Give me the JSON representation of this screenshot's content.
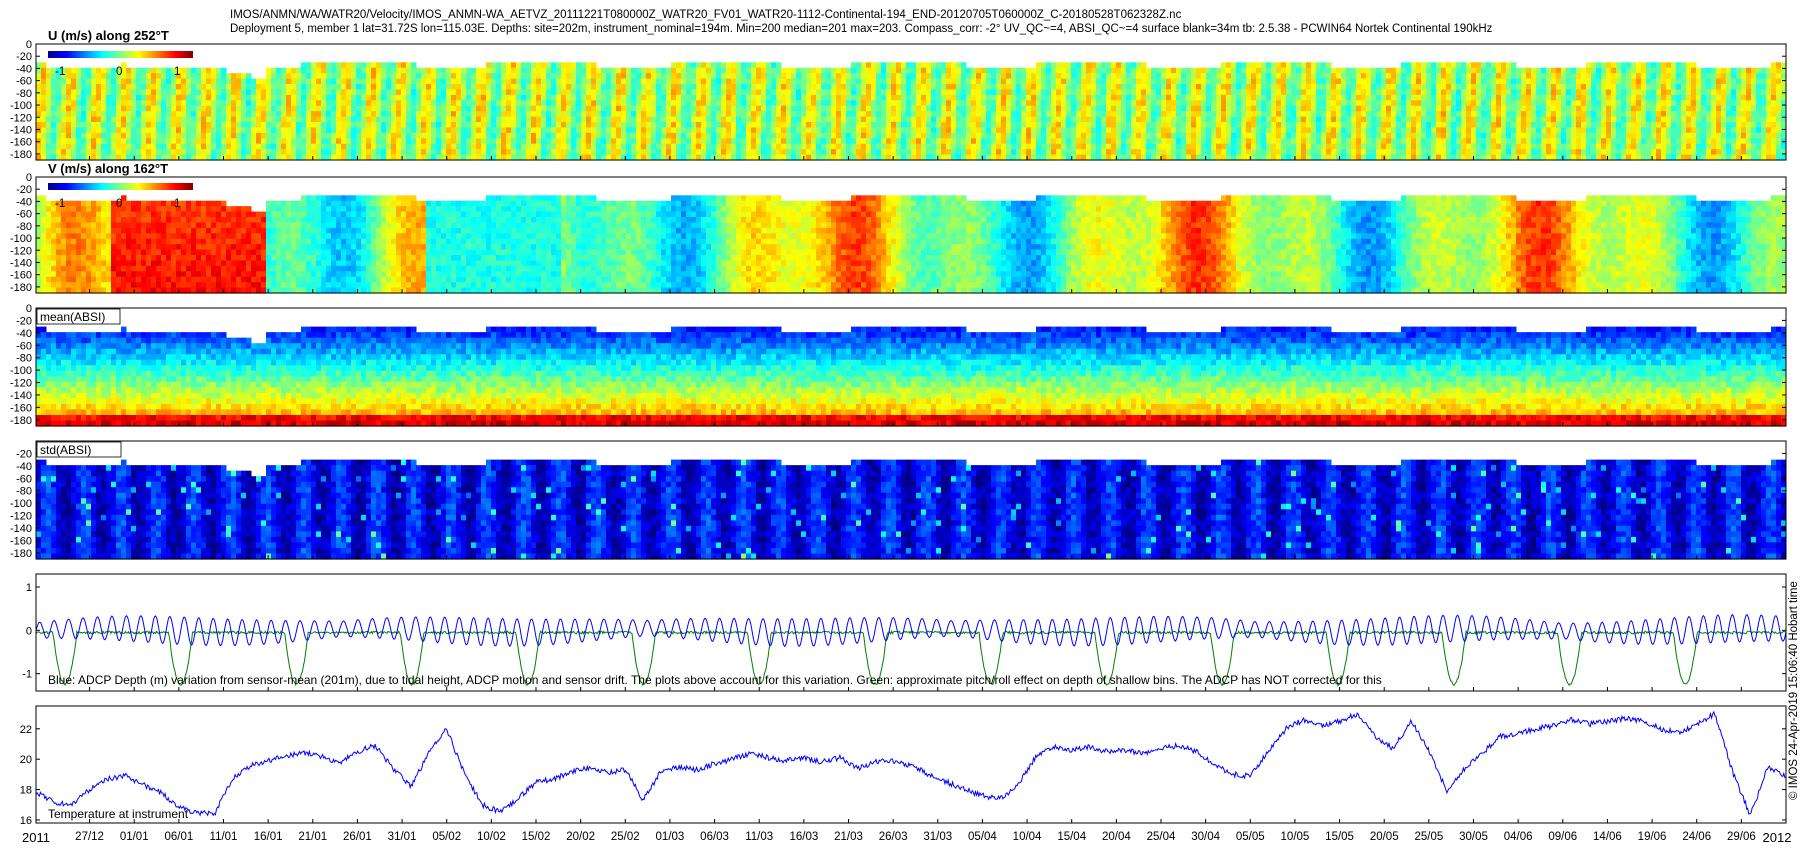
{
  "header": {
    "line1": "IMOS/ANMN/WA/WATR20/Velocity/IMOS_ANMN-WA_AETVZ_20111221T080000Z_WATR20_FV01_WATR20-1112-Continental-194_END-20120705T060000Z_C-20180528T062328Z.nc",
    "line2": "Deployment 5, member 1 lat=31.72S lon=115.03E. Depths: site=202m, instrument_nominal=194m. Min=200 median=201 max=203. Compass_corr: -2° UV_QC~=4, ABSI_QC~=4 surface blank=34m tb: 2.5.38 - PCWIN64 Nortek Continental 190kHz"
  },
  "side_note": "© IMOS 24-Apr-2019 15:06:40 Hobart time",
  "colors": {
    "axis": "#000000",
    "depth_line": "#0000ff",
    "pitch_roll_line": "#007f00",
    "temperature_line": "#0000ff",
    "blank_region": "#ffffff"
  },
  "x_axis": {
    "year_start_label": "2011",
    "year_end_label": "2012",
    "tick_labels": [
      "27/12",
      "01/01",
      "06/01",
      "11/01",
      "16/01",
      "21/01",
      "26/01",
      "31/01",
      "05/02",
      "10/02",
      "15/02",
      "20/02",
      "25/02",
      "01/03",
      "06/03",
      "11/03",
      "16/03",
      "21/03",
      "26/03",
      "31/03",
      "05/04",
      "10/04",
      "15/04",
      "20/04",
      "25/04",
      "30/04",
      "05/05",
      "10/05",
      "15/05",
      "20/05",
      "25/05",
      "30/05",
      "04/06",
      "09/06",
      "14/06",
      "19/06",
      "24/06",
      "29/06"
    ]
  },
  "colorbar": {
    "tick_labels": [
      "-1",
      "0",
      "1"
    ]
  },
  "chart_data": [
    {
      "type": "heatmap",
      "title": "U (m/s) along 252°T",
      "yticks": [
        "0",
        "-20",
        "-40",
        "-60",
        "-80",
        "-100",
        "-120",
        "-140",
        "-160",
        "-180"
      ],
      "clim": [
        -1,
        1
      ],
      "colormap": "jet",
      "has_colorbar": true
    },
    {
      "type": "heatmap",
      "title": "V (m/s) along 162°T",
      "yticks": [
        "0",
        "-20",
        "-40",
        "-60",
        "-80",
        "-100",
        "-120",
        "-140",
        "-160",
        "-180"
      ],
      "clim": [
        -1,
        1
      ],
      "colormap": "jet",
      "has_colorbar": true
    },
    {
      "type": "heatmap",
      "title": "mean(ABSI)",
      "yticks": [
        "0",
        "-20",
        "-40",
        "-60",
        "-80",
        "-100",
        "-120",
        "-140",
        "-160",
        "-180"
      ],
      "colormap": "jet",
      "has_colorbar": false
    },
    {
      "type": "heatmap",
      "title": "std(ABSI)",
      "yticks": [
        "-20",
        "-40",
        "-60",
        "-80",
        "-100",
        "-120",
        "-140",
        "-160",
        "-180"
      ],
      "colormap": "jet",
      "has_colorbar": false
    },
    {
      "type": "line",
      "yticks": [
        "1",
        "0",
        "-1"
      ],
      "ylim": [
        -1.4,
        1.3
      ],
      "caption": "Blue: ADCP Depth (m) variation from sensor-mean (201m), due to tidal height, ADCP motion and sensor drift. The plots above account for this variation. Green: approximate pitch/roll effect on depth of shallow bins. The ADCP has NOT corrected for this",
      "series": [
        {
          "color": "#0000ff",
          "amplitude": 0.3
        },
        {
          "color": "#007f00",
          "amplitude": 1.0
        }
      ]
    },
    {
      "type": "line",
      "yticks": [
        "22",
        "20",
        "18",
        "16"
      ],
      "ylim": [
        15.8,
        23.5
      ],
      "caption": "Temperature at instrument",
      "series": [
        {
          "color": "#0000ff",
          "x_days": [
            0,
            2,
            4,
            6,
            8,
            10,
            12,
            14,
            16,
            18,
            20,
            22,
            24,
            26,
            28,
            30,
            32,
            34,
            36,
            38,
            40,
            42,
            44,
            46,
            48,
            50,
            52,
            54,
            56,
            58,
            60,
            62,
            64,
            66,
            68,
            70,
            72,
            74,
            76,
            78,
            80,
            82,
            84,
            86,
            88,
            90,
            92,
            94,
            96,
            98,
            100,
            102,
            104,
            106,
            108,
            110,
            112,
            114,
            116,
            118,
            120,
            122,
            124,
            126,
            128,
            130,
            132,
            134,
            136,
            138,
            140,
            142,
            144,
            146,
            148,
            150,
            152,
            154,
            156,
            158,
            160,
            162,
            164,
            166,
            168,
            170,
            172,
            174,
            176,
            178,
            180,
            182,
            184,
            186,
            188,
            190,
            192,
            194,
            196
          ],
          "values": [
            17.8,
            17.2,
            17.0,
            18.0,
            18.7,
            18.9,
            18.3,
            17.8,
            16.8,
            16.5,
            16.4,
            18.7,
            19.6,
            19.9,
            20.2,
            20.4,
            20.2,
            19.7,
            20.5,
            20.9,
            19.4,
            18.2,
            20.4,
            22.0,
            19.0,
            17.0,
            16.5,
            17.4,
            18.5,
            18.7,
            19.2,
            19.4,
            19.1,
            19.3,
            17.3,
            19.2,
            19.5,
            19.3,
            19.7,
            20.0,
            20.4,
            20.1,
            19.9,
            20.1,
            19.8,
            20.1,
            19.4,
            19.8,
            19.9,
            19.6,
            19.0,
            18.5,
            18.0,
            17.6,
            17.4,
            18.3,
            20.2,
            20.8,
            20.6,
            20.8,
            20.5,
            20.6,
            20.4,
            20.7,
            20.9,
            20.5,
            19.6,
            19.0,
            18.9,
            20.5,
            22.0,
            22.6,
            22.2,
            22.5,
            23.0,
            21.5,
            20.7,
            22.5,
            20.6,
            17.9,
            19.4,
            20.4,
            21.5,
            21.7,
            22.0,
            22.2,
            22.6,
            22.3,
            22.5,
            22.7,
            22.5,
            22.0,
            21.7,
            22.3,
            23.0,
            19.2,
            16.3,
            19.5,
            18.9
          ]
        }
      ]
    }
  ]
}
